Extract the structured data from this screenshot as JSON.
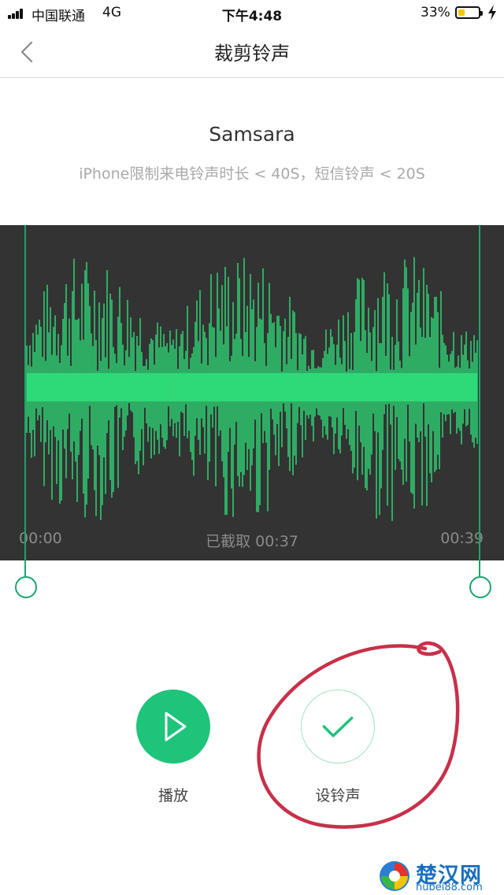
{
  "status_bar": {
    "carrier": "中国联通",
    "network": "4G",
    "time": "下午4:48",
    "battery_percent": "33%",
    "battery_level": 0.33,
    "battery_color": "#f7c600"
  },
  "nav": {
    "back_icon": "chevron-left-icon",
    "title": "裁剪铃声"
  },
  "song": {
    "title": "Samsara",
    "hint": "iPhone限制来电铃声时长 < 40S，短信铃声 < 20S"
  },
  "waveform": {
    "background": "#333333",
    "wave_color": "#2ee07a",
    "handle_color": "#1aa56a",
    "start_time": "00:00",
    "selected_label": "已截取 00:37",
    "end_time": "00:39"
  },
  "controls": {
    "play": {
      "icon": "play-icon",
      "label": "播放",
      "color": "#1ec47a"
    },
    "confirm": {
      "icon": "checkmark-icon",
      "label": "设铃声",
      "color": "#1ec47a"
    }
  },
  "annotation": {
    "color": "#c8304a"
  },
  "watermark": {
    "name": "楚汉网",
    "url": "hubei88.com"
  }
}
